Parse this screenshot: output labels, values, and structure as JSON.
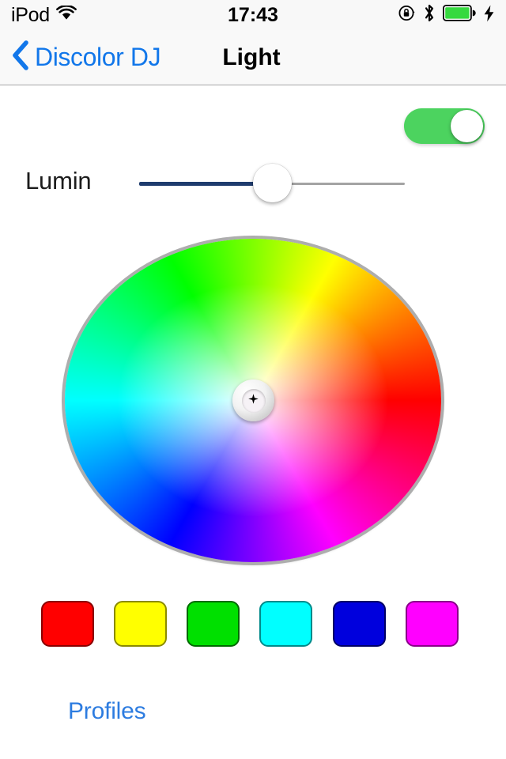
{
  "status_bar": {
    "carrier": "iPod",
    "wifi_icon": "wifi-icon",
    "time": "17:43",
    "rotation_lock_icon": "rotation-lock-icon",
    "bluetooth_icon": "bluetooth-icon",
    "battery_icon": "battery-icon",
    "charging_icon": "lightning-bolt-icon",
    "battery_level_percent": 100,
    "battery_color": "#36d93f"
  },
  "nav_bar": {
    "back_icon": "chevron-left-icon",
    "back_label": "Discolor DJ",
    "title": "Light",
    "tint_color": "#1277ea"
  },
  "controls": {
    "power_toggle": {
      "name": "power-toggle",
      "state": "on",
      "on_color": "#4cd35f"
    },
    "slider": {
      "label": "Lumin",
      "value_percent": 50,
      "fill_color": "#1f3c6e",
      "track_color": "#a3a3a3"
    }
  },
  "color_wheel": {
    "name": "color-wheel",
    "selector_icon": "crosshair-icon",
    "selector_position": "center",
    "ring_color": "#adadad"
  },
  "swatches": [
    {
      "name": "swatch-red",
      "color": "#ff0000",
      "border": "#8a0000"
    },
    {
      "name": "swatch-yellow",
      "color": "#ffff00",
      "border": "#8a8a00"
    },
    {
      "name": "swatch-green",
      "color": "#00e000",
      "border": "#006a00"
    },
    {
      "name": "swatch-cyan",
      "color": "#00ffff",
      "border": "#008a8a"
    },
    {
      "name": "swatch-blue",
      "color": "#0000dd",
      "border": "#000066"
    },
    {
      "name": "swatch-magenta",
      "color": "#ff00ff",
      "border": "#8a008a"
    }
  ],
  "footer": {
    "profiles_label": "Profiles",
    "link_color": "#2d7ce0"
  }
}
